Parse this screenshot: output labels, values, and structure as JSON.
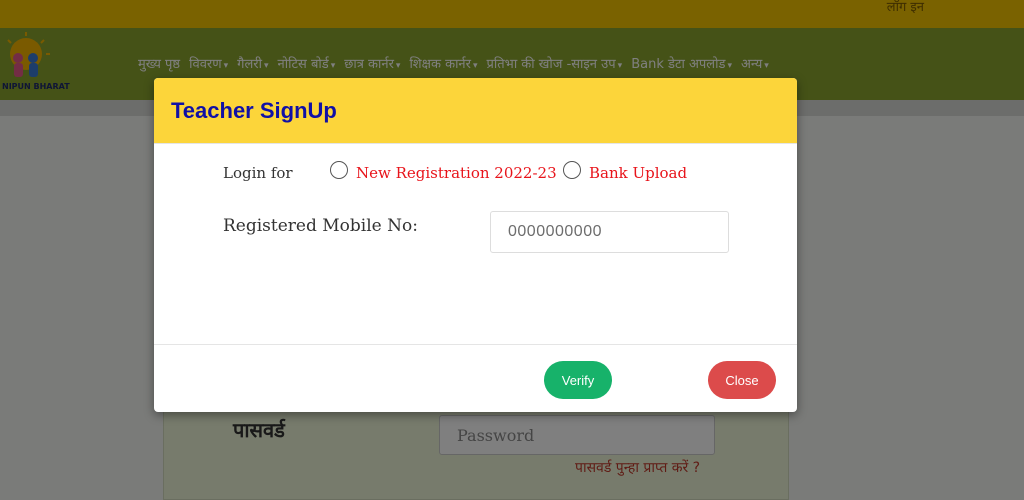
{
  "topbar": {
    "login_link": "लॉग इन"
  },
  "logo": {
    "text": "NIPUN BHARAT"
  },
  "nav": {
    "items": [
      {
        "label": "मुख्य पृष्ठ",
        "dropdown": false
      },
      {
        "label": "विवरण",
        "dropdown": true
      },
      {
        "label": "गैलरी",
        "dropdown": true
      },
      {
        "label": "नोटिस बोर्ड",
        "dropdown": true
      },
      {
        "label": "छात्र कार्नर",
        "dropdown": true
      },
      {
        "label": "शिक्षक कार्नर",
        "dropdown": true
      },
      {
        "label": "प्रतिभा की खोज -साइन उप",
        "dropdown": true
      },
      {
        "label": "Bank डेटा अपलोड",
        "dropdown": true
      },
      {
        "label": "अन्य",
        "dropdown": true
      }
    ]
  },
  "login_form": {
    "password_label": "पासवर्ड",
    "password_placeholder": "Password",
    "forgot_link": "पासवर्ड पुन्हा प्राप्त करें ?"
  },
  "modal": {
    "title": "Teacher SignUp",
    "login_for_label": "Login for",
    "options": {
      "new_registration": "New Registration 2022-23",
      "bank_upload": "Bank Upload"
    },
    "mobile_label": "Registered Mobile No:",
    "mobile_placeholder": "0000000000",
    "verify_label": "Verify",
    "close_label": "Close"
  },
  "colors": {
    "header_bg": "#fcd53a",
    "title": "#1010a6",
    "option_text": "#e8141b",
    "verify": "#17b26a",
    "close": "#dc4b4b",
    "navbar": "#8aa52f",
    "topbar": "#f4c400"
  }
}
